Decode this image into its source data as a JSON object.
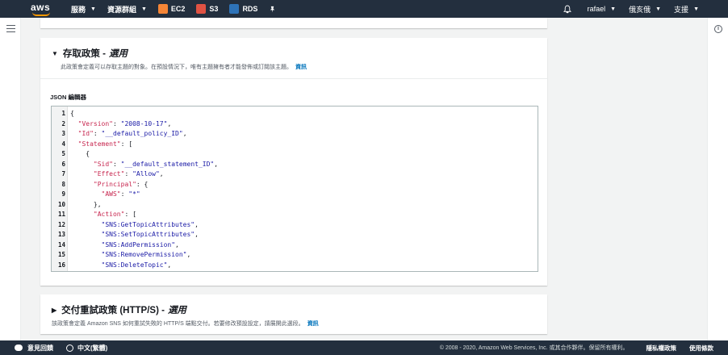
{
  "nav": {
    "logo": "aws",
    "services": "服務",
    "resource_groups": "資源群組",
    "shortcuts": [
      {
        "label": "EC2",
        "color": "#f58536"
      },
      {
        "label": "S3",
        "color": "#e05243"
      },
      {
        "label": "RDS",
        "color": "#2e73b8"
      }
    ],
    "pin_icon": "pin-icon",
    "bell_icon": "bell-icon",
    "user": "rafael",
    "region": "俄亥俄",
    "support": "支援"
  },
  "access_policy": {
    "title": "存取政策 -",
    "title_optional": "選用",
    "description": "此政策會定義可以存取主題的對象。在預設情況下，唯有主題擁有者才能發佈或訂閱該主題。",
    "info_link": "資訊",
    "editor_label": "JSON 編輯器",
    "code_lines": [
      {
        "n": "1",
        "text": "{"
      },
      {
        "n": "2",
        "text": "  \"Version\": \"2008-10-17\","
      },
      {
        "n": "3",
        "text": "  \"Id\": \"__default_policy_ID\","
      },
      {
        "n": "4",
        "text": "  \"Statement\": ["
      },
      {
        "n": "5",
        "text": "    {"
      },
      {
        "n": "6",
        "text": "      \"Sid\": \"__default_statement_ID\","
      },
      {
        "n": "7",
        "text": "      \"Effect\": \"Allow\","
      },
      {
        "n": "8",
        "text": "      \"Principal\": {"
      },
      {
        "n": "9",
        "text": "        \"AWS\": \"*\""
      },
      {
        "n": "10",
        "text": "      },"
      },
      {
        "n": "11",
        "text": "      \"Action\": ["
      },
      {
        "n": "12",
        "text": "        \"SNS:GetTopicAttributes\","
      },
      {
        "n": "13",
        "text": "        \"SNS:SetTopicAttributes\","
      },
      {
        "n": "14",
        "text": "        \"SNS:AddPermission\","
      },
      {
        "n": "15",
        "text": "        \"SNS:RemovePermission\","
      },
      {
        "n": "16",
        "text": "        \"SNS:DeleteTopic\","
      }
    ]
  },
  "retry_policy": {
    "title": "交付重試政策 (HTTP/S) -",
    "title_optional": "選用",
    "description": "該政策會定義 Amazon SNS 如何重試失敗的 HTTP/S 端點交付。若要修改預設設定，請展開此選段。",
    "info_link": "資訊"
  },
  "footer": {
    "feedback": "意見回饋",
    "language": "中文(繁體)",
    "copyright": "© 2008 - 2020, Amazon Web Services, Inc. 或其合作夥伴。保留所有權利。",
    "privacy": "隱私權政策",
    "terms": "使用條款"
  }
}
